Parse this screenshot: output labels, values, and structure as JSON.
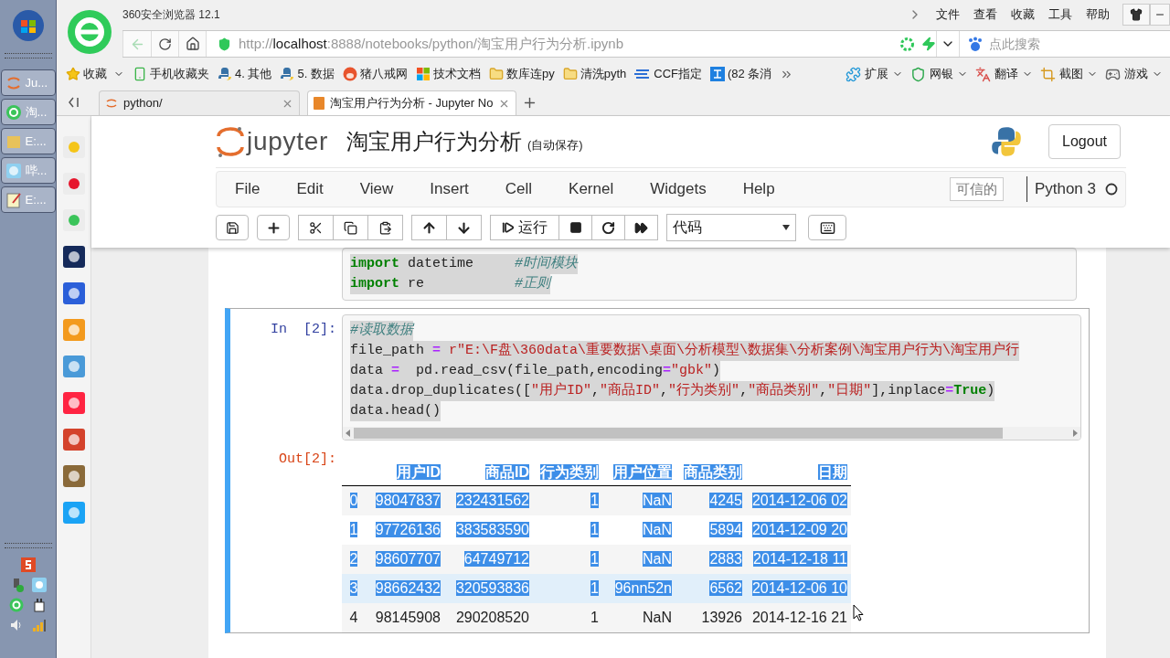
{
  "taskbar": {
    "buttons": [
      {
        "label": "Ju...",
        "kind": "jupyter"
      },
      {
        "label": "淘...",
        "kind": "browser"
      },
      {
        "label": "E:...",
        "kind": "folder"
      },
      {
        "label": "哔...",
        "kind": "anime"
      },
      {
        "label": "E:...",
        "kind": "notepad"
      }
    ]
  },
  "browser": {
    "title": "360安全浏览器 12.1",
    "menu": [
      "文件",
      "查看",
      "收藏",
      "工具",
      "帮助"
    ],
    "url": {
      "scheme": "http://",
      "host": "localhost",
      "path": ":8888/notebooks/python/淘宝用户行为分析.ipynb"
    },
    "search_placeholder": "点此搜索",
    "bookmarks": [
      {
        "label": "收藏",
        "kind": "star"
      },
      {
        "label": "手机收藏夹",
        "kind": "phone"
      },
      {
        "label": "4. 其他",
        "kind": "python"
      },
      {
        "label": "5. 数据",
        "kind": "python"
      },
      {
        "label": "猪八戒网",
        "kind": "pig"
      },
      {
        "label": "技术文档",
        "kind": "windows"
      },
      {
        "label": "数库连py",
        "kind": "folder"
      },
      {
        "label": "清洗pyth",
        "kind": "folder"
      },
      {
        "label": "CCF指定",
        "kind": "ccf"
      },
      {
        "label": "(82 条消",
        "kind": "zhihu"
      }
    ],
    "tools": [
      {
        "label": "扩展",
        "kind": "extension"
      },
      {
        "label": "网银",
        "kind": "bank"
      },
      {
        "label": "翻译",
        "kind": "translate"
      },
      {
        "label": "截图",
        "kind": "screenshot"
      },
      {
        "label": "游戏",
        "kind": "game"
      }
    ],
    "tabs": [
      {
        "label": "python/",
        "selected": false
      },
      {
        "label": "淘宝用户行为分析 - Jupyter No",
        "selected": true
      }
    ]
  },
  "jupyter": {
    "brand": "jupyter",
    "title": "淘宝用户行为分析",
    "autosave": "(自动保存)",
    "logout": "Logout",
    "menu": [
      "File",
      "Edit",
      "View",
      "Insert",
      "Cell",
      "Kernel",
      "Widgets",
      "Help"
    ],
    "trusted": "可信的",
    "kernel": "Python 3",
    "run": "运行",
    "cell_type": "代码"
  },
  "cells": [
    {
      "active": false,
      "selected_text": true,
      "lines": [
        [
          {
            "t": "import",
            "kind": "kw"
          },
          {
            "t": " datetime     ",
            "kind": "plain"
          },
          {
            "t": "#时间模块",
            "kind": "comment"
          }
        ],
        [
          {
            "t": "import",
            "kind": "kw"
          },
          {
            "t": " re           ",
            "kind": "plain"
          },
          {
            "t": "#正则",
            "kind": "comment"
          }
        ]
      ]
    },
    {
      "prompt": "In  [2]:",
      "active": true,
      "selected_text": true,
      "lines": [
        [
          {
            "t": "#读取数据",
            "kind": "comment"
          }
        ],
        [
          {
            "t": "file_path ",
            "kind": "plain"
          },
          {
            "t": "=",
            "kind": "op"
          },
          {
            "t": " r\"E:\\F盘\\360data\\重要数据\\桌面\\分析模型\\数据集\\分析案例\\淘宝用户行为\\淘宝用户行",
            "kind": "str"
          }
        ],
        [
          {
            "t": "data ",
            "kind": "plain"
          },
          {
            "t": "=",
            "kind": "op"
          },
          {
            "t": "  pd.read_csv(file_path,encoding",
            "kind": "plain"
          },
          {
            "t": "=",
            "kind": "op"
          },
          {
            "t": "\"gbk\"",
            "kind": "str"
          },
          {
            "t": ")",
            "kind": "plain"
          }
        ],
        [
          {
            "t": "data.drop_duplicates([",
            "kind": "plain"
          },
          {
            "t": "\"用户ID\"",
            "kind": "str"
          },
          {
            "t": ",",
            "kind": "plain"
          },
          {
            "t": "\"商品ID\"",
            "kind": "str"
          },
          {
            "t": ",",
            "kind": "plain"
          },
          {
            "t": "\"行为类别\"",
            "kind": "str"
          },
          {
            "t": ",",
            "kind": "plain"
          },
          {
            "t": "\"商品类别\"",
            "kind": "str"
          },
          {
            "t": ",",
            "kind": "plain"
          },
          {
            "t": "\"日期\"",
            "kind": "str"
          },
          {
            "t": "],inplace",
            "kind": "plain"
          },
          {
            "t": "=",
            "kind": "op"
          },
          {
            "t": "True",
            "kind": "kw"
          },
          {
            "t": ")",
            "kind": "plain"
          }
        ],
        [
          {
            "t": "data.head()",
            "kind": "plain"
          }
        ]
      ],
      "out_prompt": "Out[2]:",
      "table": {
        "header_selected": true,
        "columns": [
          "用户ID",
          "商品ID",
          "行为类别",
          "用户位置",
          "商品类别",
          "日期"
        ],
        "rows": [
          {
            "index": "0",
            "cells": [
              "98047837",
              "232431562",
              "1",
              "NaN",
              "4245",
              "2014-12-06 02"
            ],
            "selected": true,
            "hovered": false
          },
          {
            "index": "1",
            "cells": [
              "97726136",
              "383583590",
              "1",
              "NaN",
              "5894",
              "2014-12-09 20"
            ],
            "selected": true,
            "hovered": false
          },
          {
            "index": "2",
            "cells": [
              "98607707",
              "64749712",
              "1",
              "NaN",
              "2883",
              "2014-12-18 11"
            ],
            "selected": true,
            "hovered": false
          },
          {
            "index": "3",
            "cells": [
              "98662432",
              "320593836",
              "1",
              "96nn52n",
              "6562",
              "2014-12-06 10"
            ],
            "selected": true,
            "hovered": true
          },
          {
            "index": "4",
            "cells": [
              "98145908",
              "290208520",
              "1",
              "NaN",
              "13926",
              "2014-12-16 21"
            ],
            "selected": false,
            "hovered": false
          }
        ]
      }
    }
  ]
}
